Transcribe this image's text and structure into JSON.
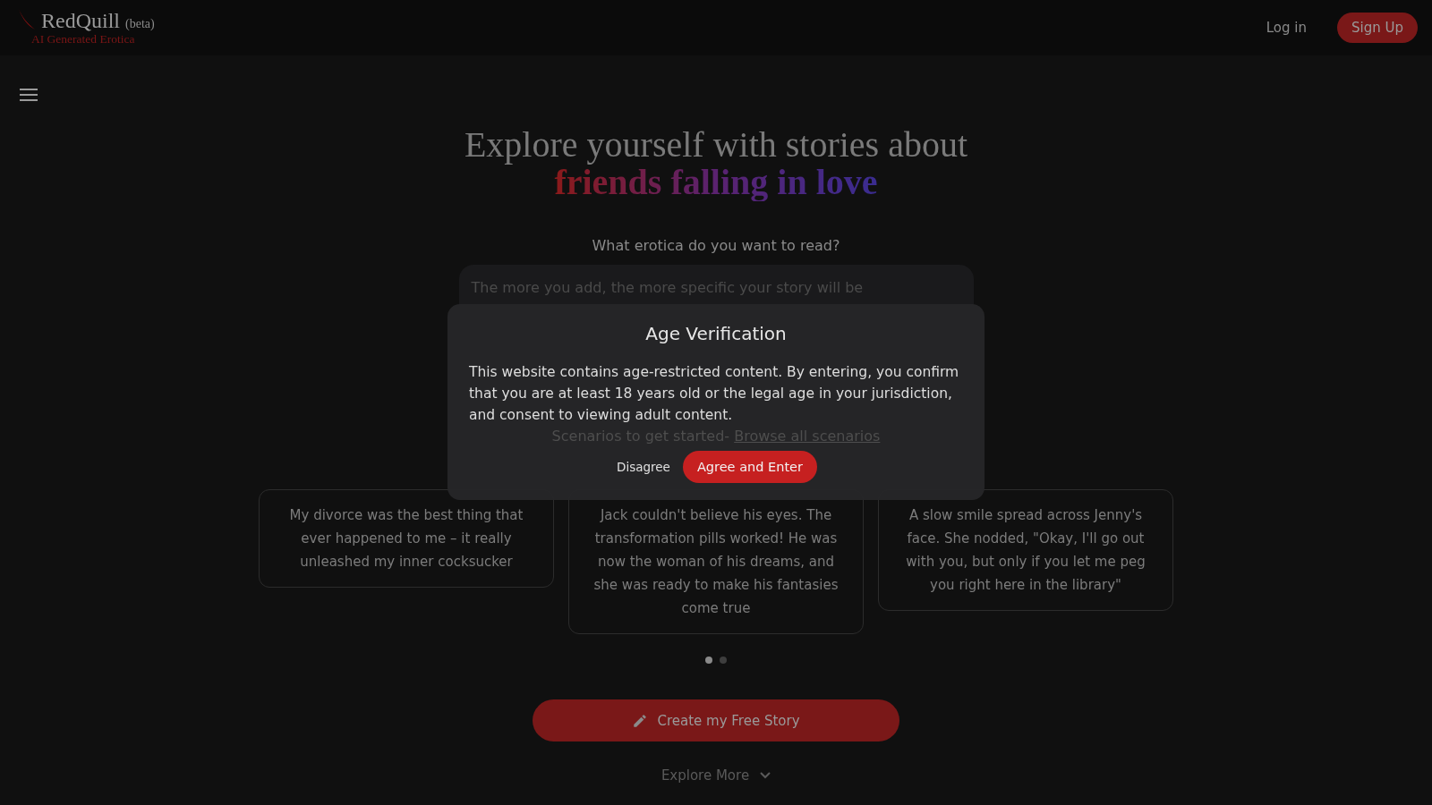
{
  "header": {
    "logo": "RedQuill",
    "badge": "(beta)",
    "tagline": "AI Generated Erotica",
    "login": "Log in",
    "signup": "Sign Up"
  },
  "hero": {
    "title": "Explore yourself with stories about",
    "highlight": "friends falling in love"
  },
  "prompt": {
    "label": "What erotica do you want to read?",
    "placeholder": "The more you add, the more specific your story will be"
  },
  "scenarios": {
    "intro": "Scenarios to get started-",
    "link": "Browse all scenarios",
    "cards": [
      {
        "text": "My divorce was the best thing that ever happened to me – it really unleashed my inner cocksucker"
      },
      {
        "text": "Jack couldn't believe his eyes. The transformation pills worked! He was now the woman of his dreams, and she was ready to make his fantasies come true"
      },
      {
        "text": "A slow smile spread across Jenny's face. She nodded, \"Okay, I'll go out with you, but only if you let me peg you right here in the library\""
      }
    ],
    "pages": [
      {
        "selected": true
      },
      {
        "selected": false
      }
    ]
  },
  "create_button": "Create my Free Story",
  "explore": "Explore More",
  "modal": {
    "title": "Age Verification",
    "body": "This website contains age-restricted content. By entering, you confirm that you are at least 18 years old or the legal age in your jurisdiction, and consent to viewing adult content.",
    "disagree": "Disagree",
    "agree": "Agree and Enter"
  }
}
